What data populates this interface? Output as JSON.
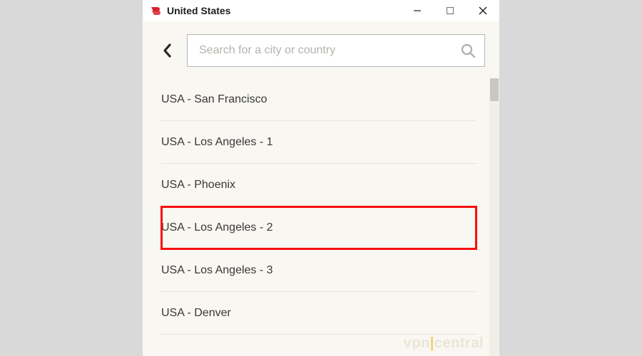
{
  "window": {
    "title": "United States",
    "icon_color": "#d9202e"
  },
  "search": {
    "placeholder": "Search for a city or country",
    "value": ""
  },
  "locations": [
    {
      "label": "USA - San Francisco",
      "highlighted": false
    },
    {
      "label": "USA - Los Angeles - 1",
      "highlighted": false
    },
    {
      "label": "USA - Phoenix",
      "highlighted": false
    },
    {
      "label": "USA - Los Angeles - 2",
      "highlighted": true
    },
    {
      "label": "USA - Los Angeles - 3",
      "highlighted": false
    },
    {
      "label": "USA - Denver",
      "highlighted": false
    }
  ],
  "watermark": {
    "part1": "vpn",
    "part2": "|",
    "part3": "central"
  }
}
